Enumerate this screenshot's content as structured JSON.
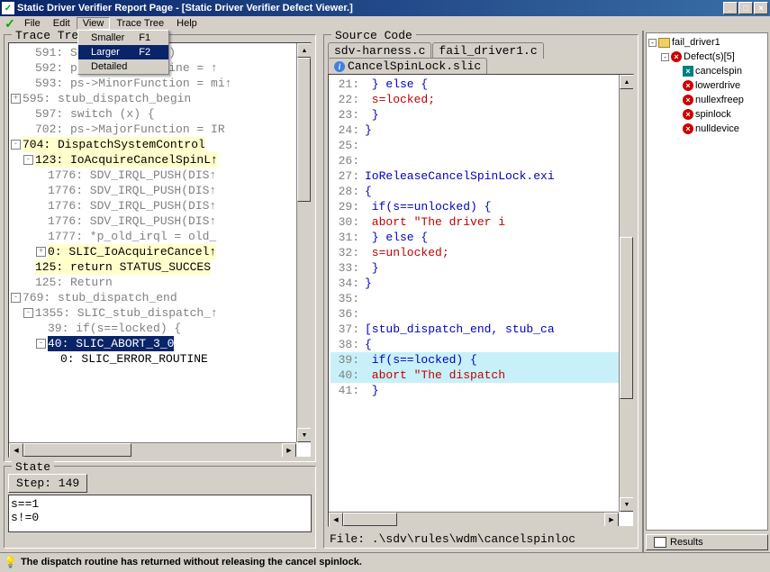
{
  "title": "Static Driver Verifier Report Page - [Static Driver Verifier Defect Viewer.]",
  "menus": {
    "file": "File",
    "edit": "Edit",
    "view": "View",
    "tracetree": "Trace Tree",
    "help": "Help"
  },
  "view_menu": {
    "smaller": "Smaller",
    "smaller_key": "F1",
    "larger": "Larger",
    "larger_key": "F2",
    "detailed": "Detailed"
  },
  "panels": {
    "tracetree": "Trace Tree",
    "sourcecode": "Source Code",
    "state": "State"
  },
  "trace": [
    {
      "indent": 14,
      "glyph": "",
      "cls": "gray",
      "text": "591: SdvMakeChoice()"
    },
    {
      "indent": 14,
      "glyph": "",
      "cls": "gray",
      "text": "592: ps->CancelRoutine = ↑"
    },
    {
      "indent": 14,
      "glyph": "",
      "cls": "gray",
      "text": "593: ps->MinorFunction = mi↑"
    },
    {
      "indent": 0,
      "glyph": "+",
      "cls": "gray",
      "text": "595: stub_dispatch_begin"
    },
    {
      "indent": 14,
      "glyph": "",
      "cls": "gray",
      "text": "597: switch (x) {"
    },
    {
      "indent": 14,
      "glyph": "",
      "cls": "gray",
      "text": "702: ps->MajorFunction = IR"
    },
    {
      "indent": 0,
      "glyph": "-",
      "cls": "hl-yellow",
      "text": "704: DispatchSystemControl"
    },
    {
      "indent": 14,
      "glyph": "-",
      "cls": "hl-yellow",
      "text": "123: IoAcquireCancelSpinL↑"
    },
    {
      "indent": 28,
      "glyph": "",
      "cls": "gray",
      "text": "1776: SDV_IRQL_PUSH(DIS↑"
    },
    {
      "indent": 28,
      "glyph": "",
      "cls": "gray",
      "text": "1776: SDV_IRQL_PUSH(DIS↑"
    },
    {
      "indent": 28,
      "glyph": "",
      "cls": "gray",
      "text": "1776: SDV_IRQL_PUSH(DIS↑"
    },
    {
      "indent": 28,
      "glyph": "",
      "cls": "gray",
      "text": "1776: SDV_IRQL_PUSH(DIS↑"
    },
    {
      "indent": 28,
      "glyph": "",
      "cls": "gray",
      "text": "1777: *p_old_irql = old_"
    },
    {
      "indent": 28,
      "glyph": "+",
      "cls": "hl-yellow",
      "text": "0: SLIC_IoAcquireCancel↑"
    },
    {
      "indent": 14,
      "glyph": "",
      "cls": "hl-yellow",
      "text": "125: return STATUS_SUCCES"
    },
    {
      "indent": 14,
      "glyph": "",
      "cls": "gray",
      "text": "125: Return"
    },
    {
      "indent": 0,
      "glyph": "-",
      "cls": "gray",
      "text": "769: stub_dispatch_end"
    },
    {
      "indent": 14,
      "glyph": "-",
      "cls": "gray",
      "text": "1355: SLIC_stub_dispatch_↑"
    },
    {
      "indent": 28,
      "glyph": "",
      "cls": "gray",
      "text": "39: if(s==locked) {"
    },
    {
      "indent": 28,
      "glyph": "-",
      "cls": "hl-navy",
      "text": "40: SLIC_ABORT_3_0"
    },
    {
      "indent": 42,
      "glyph": "",
      "cls": "",
      "text": "0: SLIC_ERROR_ROUTINE"
    }
  ],
  "step_label": "Step: 149",
  "state_lines": [
    "s==1",
    "s!=0"
  ],
  "tabs": {
    "t1": "sdv-harness.c",
    "t2": "fail_driver1.c",
    "t3": "CancelSpinLock.slic"
  },
  "source": [
    {
      "n": "21",
      "cls": "blue",
      "t": "    } else {"
    },
    {
      "n": "22",
      "cls": "red",
      "t": "        s=locked;"
    },
    {
      "n": "23",
      "cls": "blue",
      "t": "    }"
    },
    {
      "n": "24",
      "cls": "blue",
      "t": "}"
    },
    {
      "n": "25",
      "cls": "blue",
      "t": ""
    },
    {
      "n": "26",
      "cls": "blue",
      "t": ""
    },
    {
      "n": "27",
      "cls": "blue",
      "t": "IoReleaseCancelSpinLock.exi"
    },
    {
      "n": "28",
      "cls": "blue",
      "t": "{"
    },
    {
      "n": "29",
      "cls": "blue",
      "t": "    if(s==unlocked) {"
    },
    {
      "n": "30",
      "cls": "red",
      "t": "        abort \"The driver i"
    },
    {
      "n": "31",
      "cls": "blue",
      "t": "    } else {"
    },
    {
      "n": "32",
      "cls": "red",
      "t": "        s=unlocked;"
    },
    {
      "n": "33",
      "cls": "blue",
      "t": "    }"
    },
    {
      "n": "34",
      "cls": "blue",
      "t": "}"
    },
    {
      "n": "35",
      "cls": "blue",
      "t": ""
    },
    {
      "n": "36",
      "cls": "blue",
      "t": ""
    },
    {
      "n": "37",
      "cls": "blue",
      "t": "[stub_dispatch_end, stub_ca"
    },
    {
      "n": "38",
      "cls": "blue",
      "t": "{"
    },
    {
      "n": "39",
      "cls": "blue",
      "t": "    if(s==locked) {",
      "hl": true
    },
    {
      "n": "40",
      "cls": "red",
      "t": "        abort \"The dispatch",
      "hl": true
    },
    {
      "n": "41",
      "cls": "blue",
      "t": "    }"
    }
  ],
  "file_line": "File: .\\sdv\\rules\\wdm\\cancelspinloc",
  "defect_root": "fail_driver1",
  "defect_group": "Defect(s)[5]",
  "defects": [
    "cancelspin",
    "lowerdrive",
    "nullexfreep",
    "spinlock",
    "nulldevice"
  ],
  "results_label": "Results",
  "status_text": "The dispatch routine has returned without releasing the cancel spinlock."
}
